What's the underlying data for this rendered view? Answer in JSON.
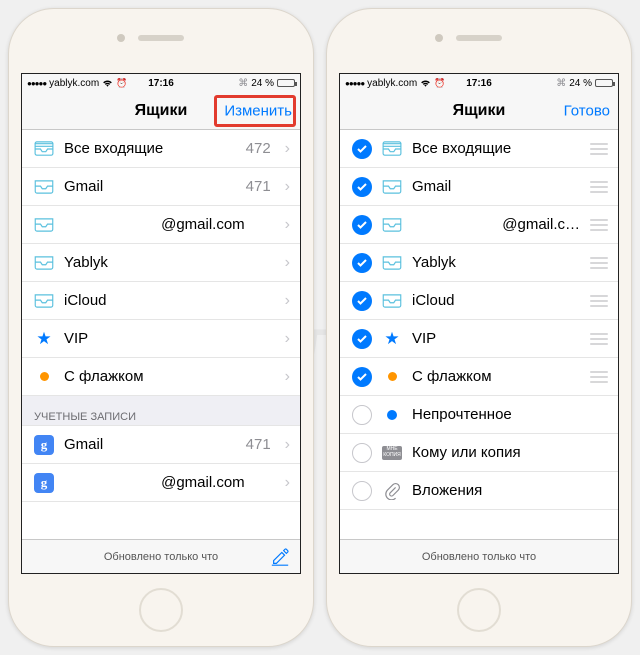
{
  "watermark": "Яблык",
  "status": {
    "carrier": "yablyk.com",
    "time": "17:16",
    "battery": "24 %"
  },
  "left": {
    "nav_title": "Ящики",
    "nav_action": "Изменить",
    "rows": [
      {
        "icon": "inbox-all",
        "label": "Все входящие",
        "count": "472"
      },
      {
        "icon": "inbox",
        "label": "Gmail",
        "count": "471"
      },
      {
        "icon": "inbox",
        "label": "@gmail.com",
        "count": ""
      },
      {
        "icon": "inbox",
        "label": "Yablyk",
        "count": ""
      },
      {
        "icon": "inbox",
        "label": "iCloud",
        "count": ""
      },
      {
        "icon": "star",
        "label": "VIP",
        "count": ""
      },
      {
        "icon": "flag",
        "label": "С флажком",
        "count": ""
      }
    ],
    "section": "УЧЕТНЫЕ ЗАПИСИ",
    "accounts": [
      {
        "label": "Gmail",
        "count": "471"
      },
      {
        "label": "@gmail.com",
        "count": ""
      }
    ],
    "toolbar": "Обновлено только что"
  },
  "right": {
    "nav_title": "Ящики",
    "nav_action": "Готово",
    "rows": [
      {
        "checked": true,
        "icon": "inbox-all",
        "label": "Все входящие"
      },
      {
        "checked": true,
        "icon": "inbox",
        "label": "Gmail"
      },
      {
        "checked": true,
        "icon": "inbox",
        "label": "@gmail.c…"
      },
      {
        "checked": true,
        "icon": "inbox",
        "label": "Yablyk"
      },
      {
        "checked": true,
        "icon": "inbox",
        "label": "iCloud"
      },
      {
        "checked": true,
        "icon": "star",
        "label": "VIP"
      },
      {
        "checked": true,
        "icon": "flag",
        "label": "С флажком"
      },
      {
        "checked": false,
        "icon": "unread",
        "label": "Непрочтенное"
      },
      {
        "checked": false,
        "icon": "cc",
        "label": "Кому или копия"
      },
      {
        "checked": false,
        "icon": "attach",
        "label": "Вложения"
      }
    ],
    "toolbar": "Обновлено только что"
  },
  "cc_badge": {
    "l1": "МНЕ",
    "l2": "КОПИЯ"
  }
}
